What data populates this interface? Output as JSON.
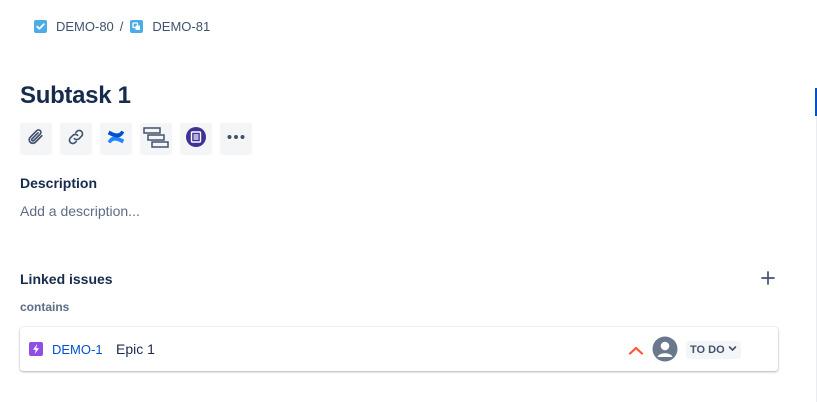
{
  "breadcrumb": {
    "items": [
      {
        "key": "DEMO-80",
        "icon": "task-checkbox-icon"
      },
      {
        "key": "DEMO-81",
        "icon": "subtask-icon"
      }
    ],
    "separator": "/"
  },
  "issue": {
    "title": "Subtask 1"
  },
  "toolbar": {
    "buttons": [
      "attachment-icon",
      "link-icon",
      "confluence-icon",
      "child-issues-icon",
      "app-icon",
      "more-icon"
    ]
  },
  "description": {
    "label": "Description",
    "placeholder": "Add a description..."
  },
  "linked_issues": {
    "label": "Linked issues",
    "relation": "contains",
    "items": [
      {
        "key": "DEMO-1",
        "summary": "Epic 1",
        "type_icon": "epic-icon",
        "priority_icon": "priority-high-icon",
        "assignee_icon": "unassigned-avatar-icon",
        "status": "TO DO"
      }
    ]
  },
  "colors": {
    "link": "#0052cc",
    "epic": "#904ee2",
    "task": "#4bade8",
    "priority_high": "#ff5630",
    "text": "#172b4d"
  }
}
